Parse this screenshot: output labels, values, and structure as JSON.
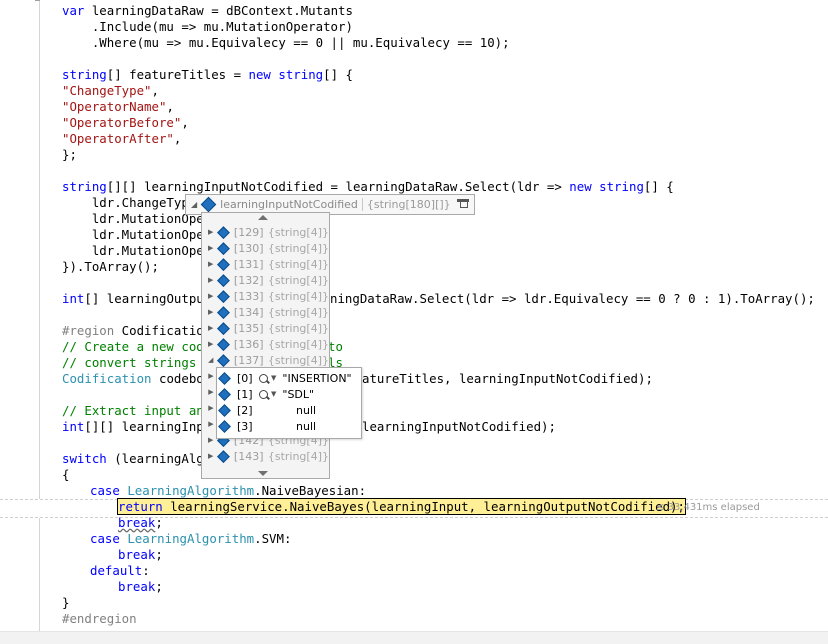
{
  "code": {
    "line_01": [
      "var",
      " learningDataRaw = dBContext.Mutants"
    ],
    "line_02": "    .Include(mu => mu.MutationOperator)",
    "line_03": "    .Where(mu => mu.Equivalecy == 0 || mu.Equivalecy == 10);",
    "line_04": [
      "string",
      "[] featureTitles = ",
      "new",
      " ",
      "string",
      "[] {"
    ],
    "line_05": "\"ChangeType\"",
    "line_06": "\"OperatorName\"",
    "line_07": "\"OperatorBefore\"",
    "line_08": "\"OperatorAfter\"",
    "line_09": "};",
    "line_10": [
      "string",
      "[][] learningInputNotCodified = learningDataRaw.Select(ldr => ",
      "new",
      " ",
      "string",
      "[] {"
    ],
    "line_11": "    ldr.ChangeTyp",
    "line_12": "    ldr.MutationOper",
    "line_13": "    ldr.MutationOper",
    "line_14": "    ldr.MutationOper",
    "line_15": "}).ToArray();",
    "line_16a": [
      "int",
      "[] learningOutput"
    ],
    "line_16b": "ningDataRaw.Select(ldr => ldr.Equivalecy == 0 ? 0 : 1).ToArray();",
    "line_17a": "#region",
    "line_17b": " Codification",
    "line_18": "// Create a new codi",
    "line_18b": "to",
    "line_19": "// convert strings i",
    "line_19b": "ls",
    "line_20a": "Codification",
    "line_20b": " codebo",
    "line_20c": "atureTitles, learningInputNotCodified);",
    "line_21": "// Extract input and",
    "line_22a": [
      "int",
      "[][] learningInpu"
    ],
    "line_22b": "learningInputNotCodified);",
    "line_23a": "switch",
    "line_23b": " (learningAlgo",
    "line_24": "{",
    "line_25": [
      "case",
      " ",
      "LearningAlgorithm",
      ".NaiveBayesian:"
    ],
    "line_26": [
      "return",
      " learningService.NaiveBayes(learningInput, learningOutputNotCodified);"
    ],
    "line_27": "break",
    "line_27b": ";",
    "line_28": [
      "case",
      " ",
      "LearningAlgorithm",
      ".SVM:"
    ],
    "line_29": [
      "break",
      ";"
    ],
    "line_30": [
      "default",
      ":"
    ],
    "line_31": [
      "break",
      ";"
    ],
    "line_32": "}",
    "line_33": "#endregion"
  },
  "elapsed": "≤ 33,431ms elapsed",
  "datatip": {
    "name": "learningInputNotCodified",
    "value": "{string[180][]}",
    "rows": [
      {
        "idx": "[129]",
        "val": "{string[4]}"
      },
      {
        "idx": "[130]",
        "val": "{string[4]}"
      },
      {
        "idx": "[131]",
        "val": "{string[4]}"
      },
      {
        "idx": "[132]",
        "val": "{string[4]}"
      },
      {
        "idx": "[133]",
        "val": "{string[4]}"
      },
      {
        "idx": "[134]",
        "val": "{string[4]}"
      },
      {
        "idx": "[135]",
        "val": "{string[4]}"
      },
      {
        "idx": "[136]",
        "val": "{string[4]}"
      },
      {
        "idx": "[137]",
        "val": "{string[4]}"
      },
      {
        "idx": "[142]",
        "val": "{string[4]}"
      },
      {
        "idx": "[143]",
        "val": "{string[4]}"
      }
    ],
    "sub_rows": [
      {
        "idx": "[0]",
        "val": "\"INSERTION\""
      },
      {
        "idx": "[1]",
        "val": "\"SDL\""
      },
      {
        "idx": "[2]",
        "val": "null"
      },
      {
        "idx": "[3]",
        "val": "null"
      }
    ]
  },
  "colors": {
    "keyword": "#0000ff",
    "string": "#a31515",
    "comment": "#008000",
    "type": "#2b91af",
    "exec_highlight": "#ffef96"
  }
}
